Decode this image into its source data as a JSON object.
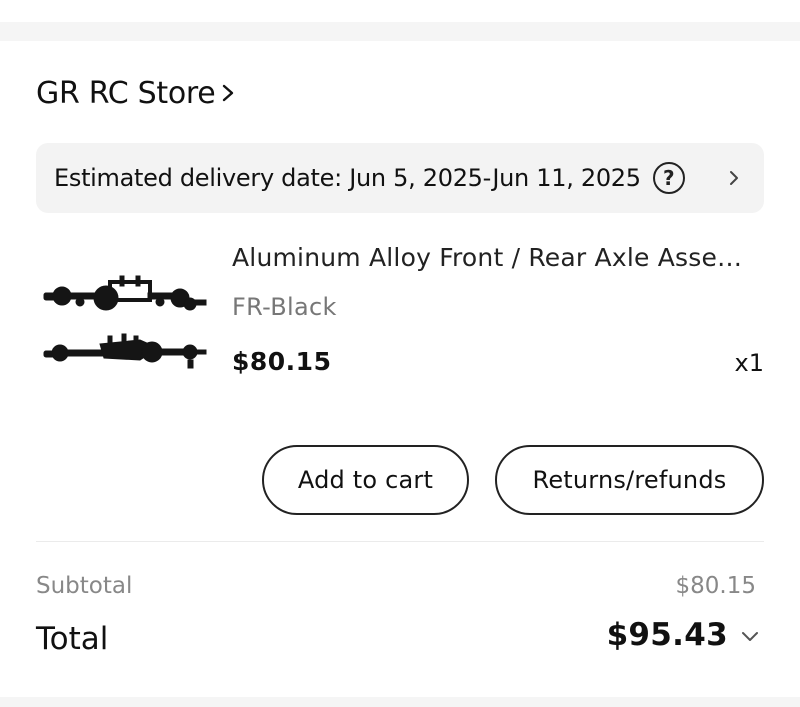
{
  "store": {
    "name": "GR RC Store"
  },
  "delivery": {
    "text": "Estimated delivery date: Jun 5, 2025-Jun 11, 2025",
    "help_glyph": "?"
  },
  "product": {
    "title": "Aluminum Alloy Front / Rear Axle Assembl...",
    "variant": "FR-Black",
    "price": "$80.15",
    "quantity": "x1"
  },
  "actions": {
    "add_to_cart": "Add to cart",
    "returns": "Returns/refunds"
  },
  "summary": {
    "subtotal_label": "Subtotal",
    "subtotal_value": "$80.15",
    "total_label": "Total",
    "total_value": "$95.43"
  },
  "colors": {
    "background": "#f5f5f5",
    "card": "#ffffff",
    "delivery_bar": "#f3f3f3",
    "text_primary": "#111111",
    "text_muted": "#888888"
  },
  "icons": {
    "store_chevron": "chevron-right-icon",
    "help": "question-circle-icon",
    "delivery_chevron": "chevron-right-icon",
    "total_chevron": "chevron-down-icon"
  }
}
